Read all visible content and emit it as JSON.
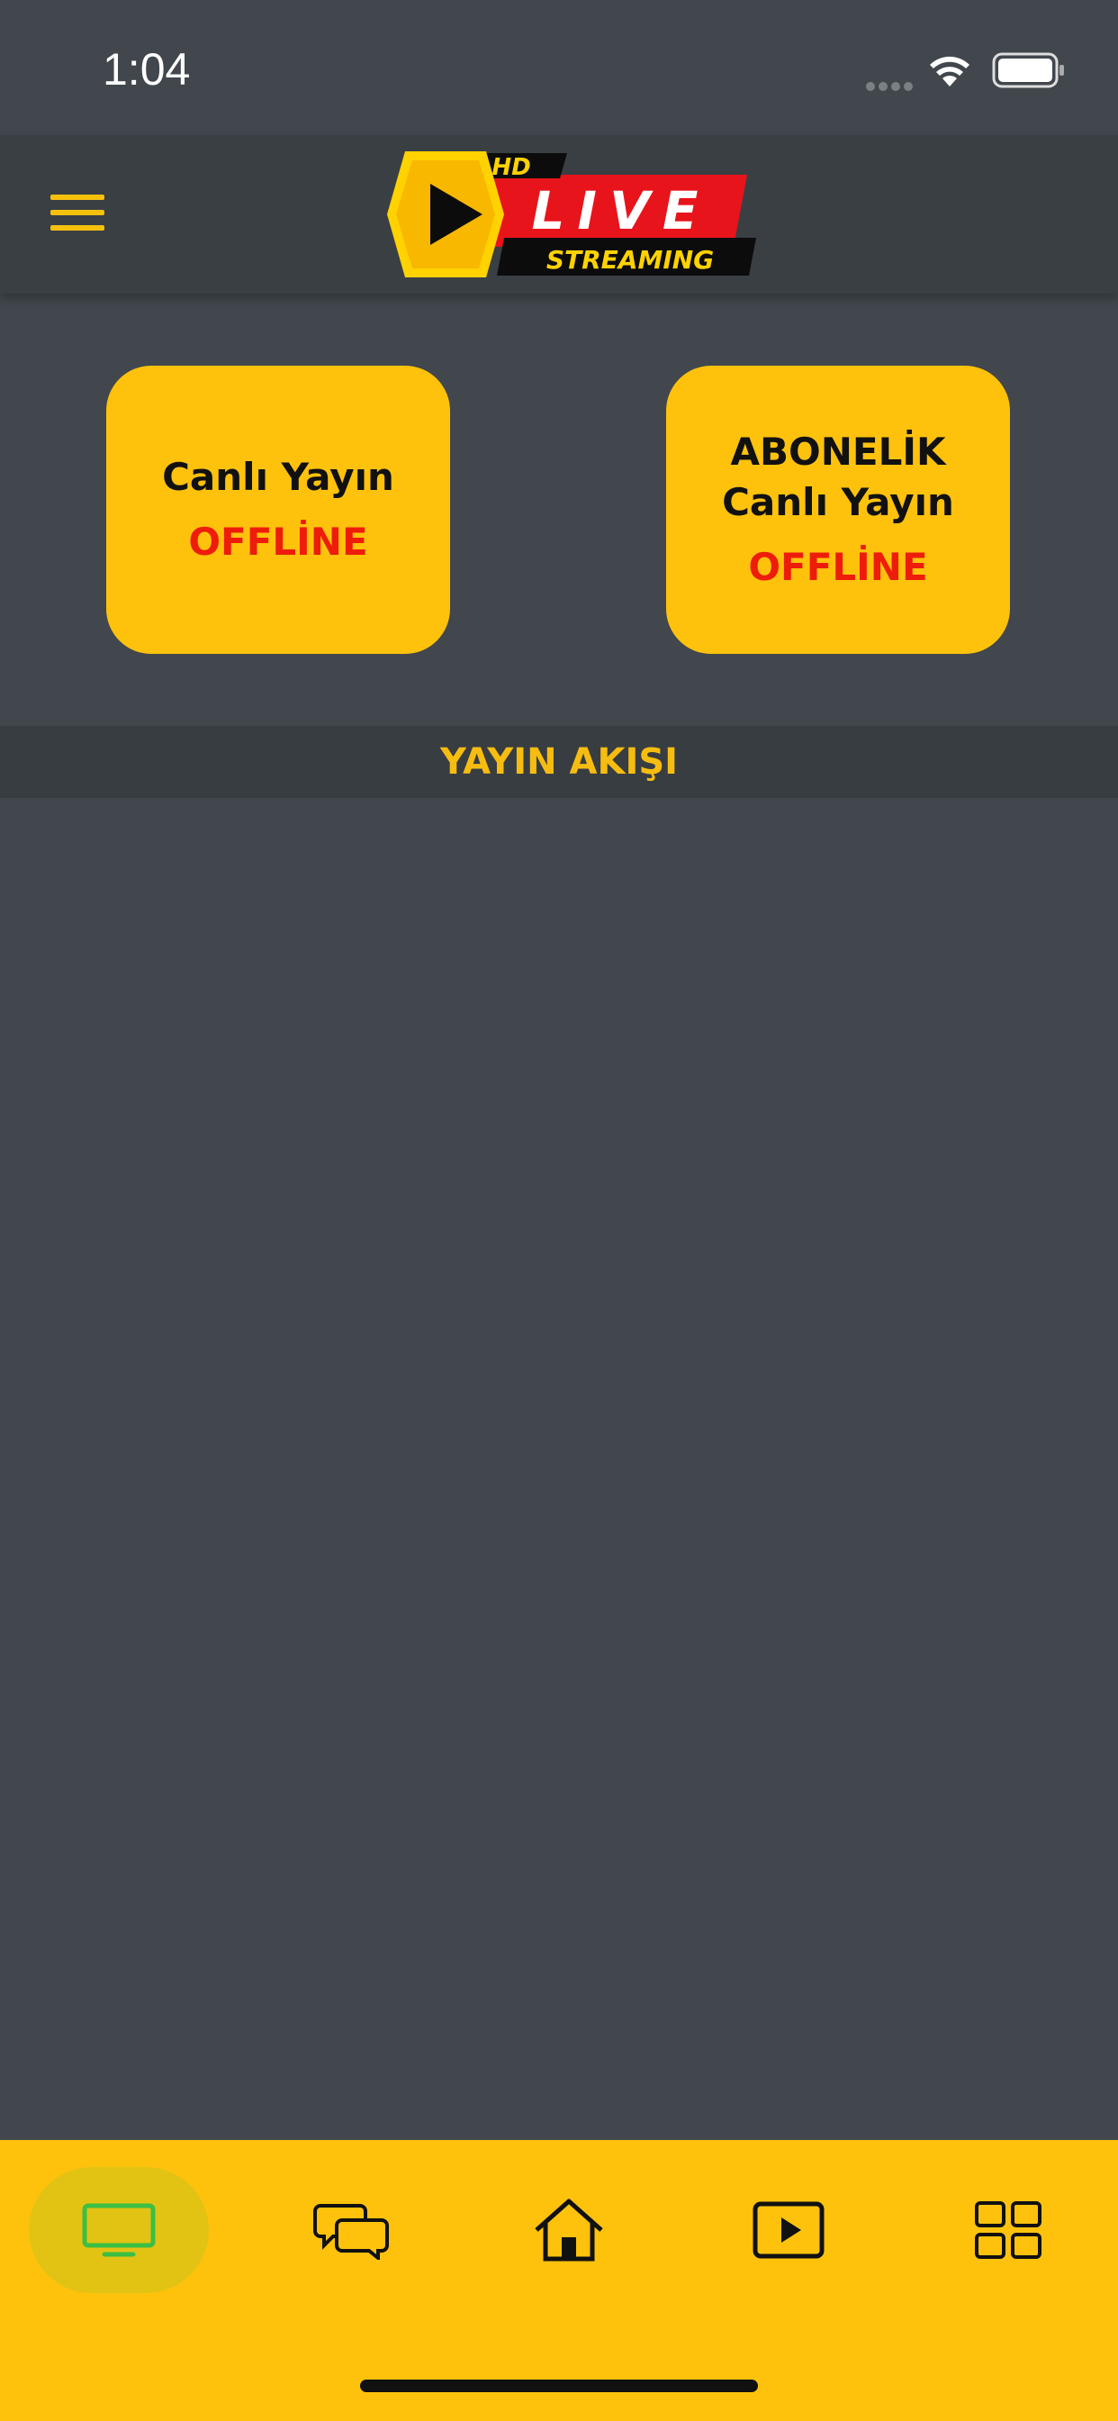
{
  "status_bar": {
    "time": "1:04"
  },
  "logo": {
    "hd": "HD",
    "live": "LIVE",
    "streaming": "STREAMING"
  },
  "cards": [
    {
      "title_lines": [
        "Canlı Yayın"
      ],
      "status": "OFFLİNE"
    },
    {
      "title_lines": [
        "ABONELİK",
        "Canlı Yayın"
      ],
      "status": "OFFLİNE"
    }
  ],
  "section": {
    "title": "YAYIN AKIŞI"
  },
  "tabs": [
    {
      "icon": "tv-icon",
      "active": true
    },
    {
      "icon": "chat-icon",
      "active": false
    },
    {
      "icon": "home-icon",
      "active": false
    },
    {
      "icon": "play-icon",
      "active": false
    },
    {
      "icon": "grid-icon",
      "active": false
    }
  ],
  "colors": {
    "background": "#41474c",
    "accent": "#fec20c",
    "offline": "#ee1c0b",
    "active_tab_icon": "#3bbf44"
  }
}
